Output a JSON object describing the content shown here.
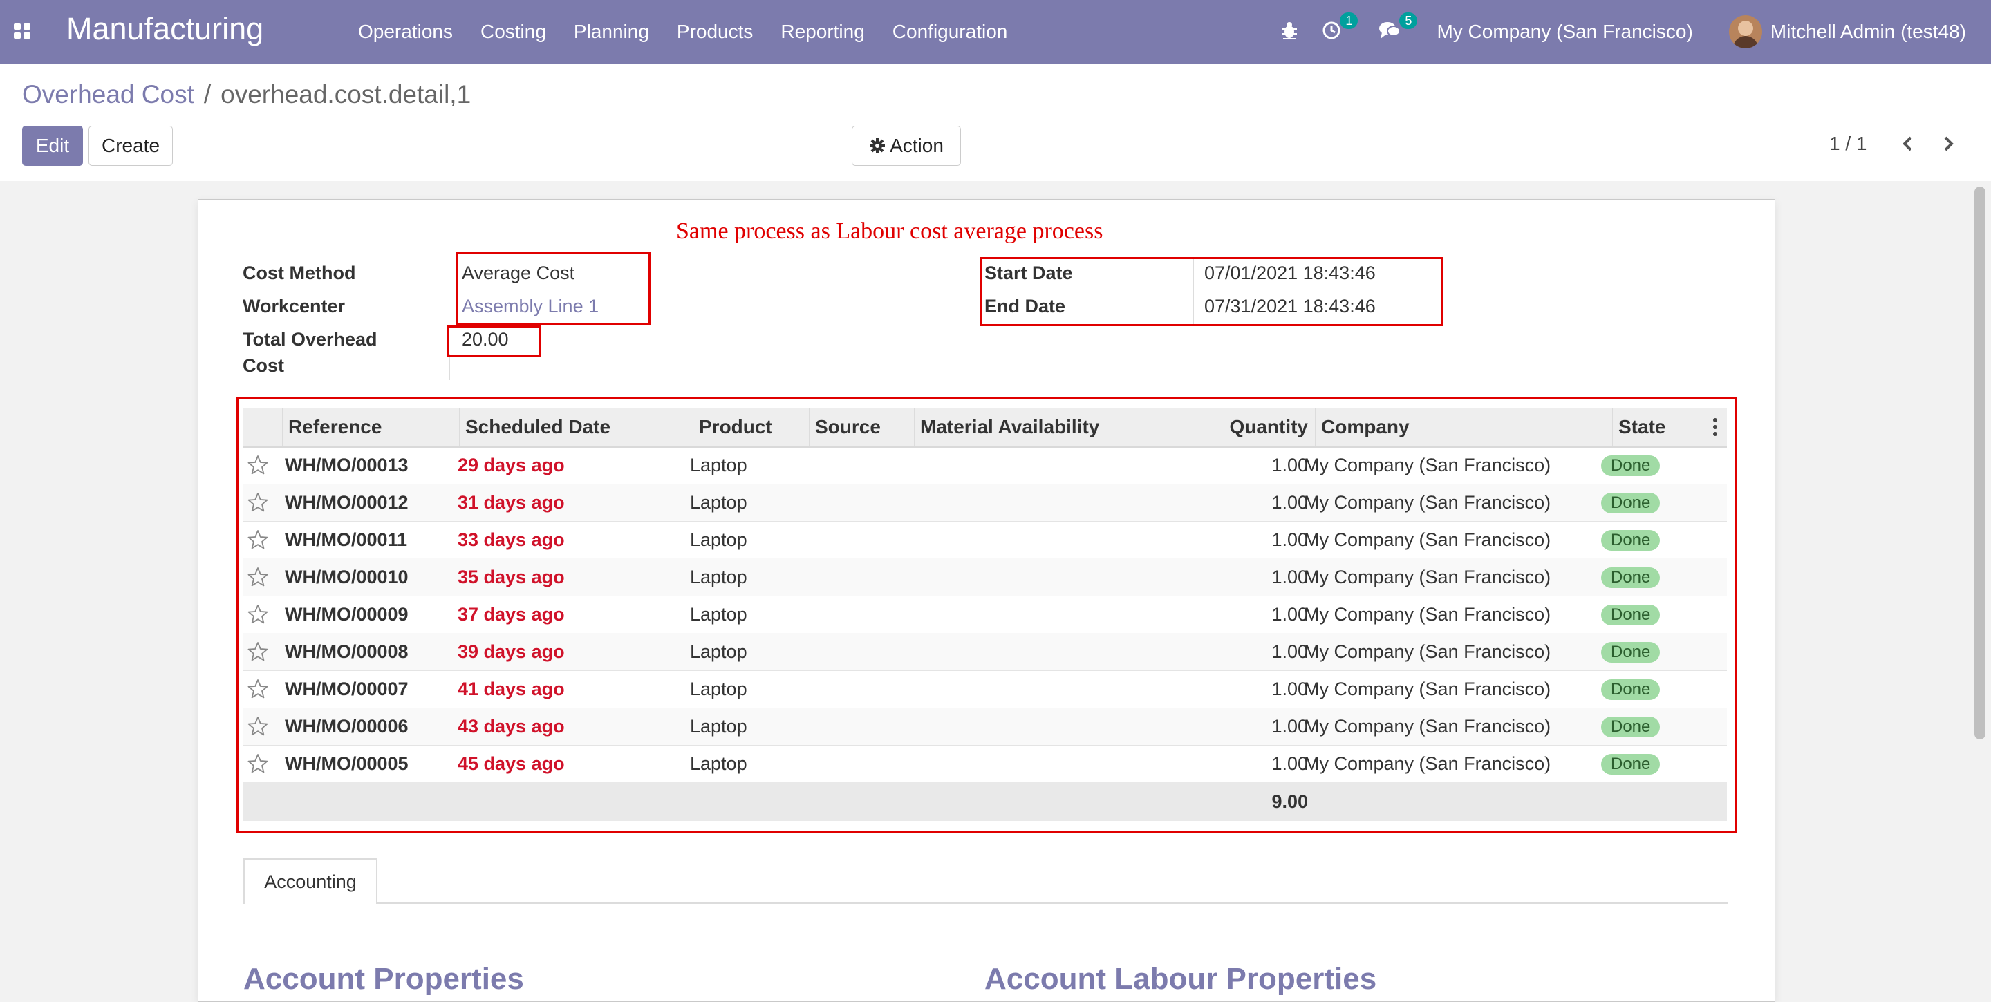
{
  "navbar": {
    "app_title": "Manufacturing",
    "menu": [
      "Operations",
      "Costing",
      "Planning",
      "Products",
      "Reporting",
      "Configuration"
    ],
    "activity_count": "1",
    "messages_count": "5",
    "company": "My Company (San Francisco)",
    "user": "Mitchell Admin (test48)"
  },
  "control_panel": {
    "breadcrumb_parent": "Overhead Cost",
    "breadcrumb_separator": "/",
    "breadcrumb_current": "overhead.cost.detail,1",
    "edit_label": "Edit",
    "create_label": "Create",
    "action_label": "Action",
    "pager": "1 / 1"
  },
  "annotation": {
    "title": "Same process as Labour cost average process",
    "color": "#e00000"
  },
  "form": {
    "cost_method_label": "Cost Method",
    "cost_method_value": "Average Cost",
    "workcenter_label": "Workcenter",
    "workcenter_value": "Assembly Line 1",
    "total_overhead_label_1": "Total Overhead",
    "total_overhead_label_2": "Cost",
    "total_overhead_value": "20.00",
    "start_date_label": "Start Date",
    "start_date_value": "07/01/2021 18:43:46",
    "end_date_label": "End Date",
    "end_date_value": "07/31/2021 18:43:46"
  },
  "table": {
    "columns": [
      "Reference",
      "Scheduled Date",
      "Product",
      "Source",
      "Material Availability",
      "Quantity",
      "Company",
      "State"
    ],
    "rows": [
      {
        "reference": "WH/MO/00013",
        "scheduled": "29 days ago",
        "product": "Laptop",
        "source": "",
        "availability": "",
        "quantity": "1.00",
        "company": "My Company (San Francisco)",
        "state": "Done"
      },
      {
        "reference": "WH/MO/00012",
        "scheduled": "31 days ago",
        "product": "Laptop",
        "source": "",
        "availability": "",
        "quantity": "1.00",
        "company": "My Company (San Francisco)",
        "state": "Done"
      },
      {
        "reference": "WH/MO/00011",
        "scheduled": "33 days ago",
        "product": "Laptop",
        "source": "",
        "availability": "",
        "quantity": "1.00",
        "company": "My Company (San Francisco)",
        "state": "Done"
      },
      {
        "reference": "WH/MO/00010",
        "scheduled": "35 days ago",
        "product": "Laptop",
        "source": "",
        "availability": "",
        "quantity": "1.00",
        "company": "My Company (San Francisco)",
        "state": "Done"
      },
      {
        "reference": "WH/MO/00009",
        "scheduled": "37 days ago",
        "product": "Laptop",
        "source": "",
        "availability": "",
        "quantity": "1.00",
        "company": "My Company (San Francisco)",
        "state": "Done"
      },
      {
        "reference": "WH/MO/00008",
        "scheduled": "39 days ago",
        "product": "Laptop",
        "source": "",
        "availability": "",
        "quantity": "1.00",
        "company": "My Company (San Francisco)",
        "state": "Done"
      },
      {
        "reference": "WH/MO/00007",
        "scheduled": "41 days ago",
        "product": "Laptop",
        "source": "",
        "availability": "",
        "quantity": "1.00",
        "company": "My Company (San Francisco)",
        "state": "Done"
      },
      {
        "reference": "WH/MO/00006",
        "scheduled": "43 days ago",
        "product": "Laptop",
        "source": "",
        "availability": "",
        "quantity": "1.00",
        "company": "My Company (San Francisco)",
        "state": "Done"
      },
      {
        "reference": "WH/MO/00005",
        "scheduled": "45 days ago",
        "product": "Laptop",
        "source": "",
        "availability": "",
        "quantity": "1.00",
        "company": "My Company (San Francisco)",
        "state": "Done"
      }
    ],
    "total_quantity": "9.00"
  },
  "tabs": {
    "accounting": "Accounting"
  },
  "sections": {
    "left_heading": "Account Properties",
    "right_heading": "Account Labour Properties"
  },
  "colors": {
    "brand": "#7c7bad",
    "overdue": "#d0122a",
    "state_done": "#a1dba5"
  }
}
